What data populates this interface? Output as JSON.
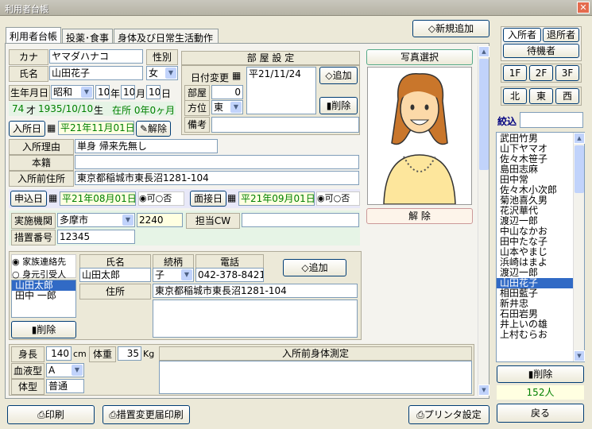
{
  "window": {
    "title": "利用者台帳",
    "close": "✕"
  },
  "tabs": [
    "利用者台帳",
    "投薬･食事",
    "身体及び日常生活動作"
  ],
  "new_button": "新規追加",
  "basic": {
    "kana_label": "カナ",
    "kana": "ヤマダハナコ",
    "sex_label": "性別",
    "name_label": "氏名",
    "name": "山田花子",
    "sex": "女",
    "birth_label": "生年月日",
    "era": "昭和",
    "year": "10",
    "year_unit": "年",
    "month": "10",
    "month_unit": "月",
    "day": "10",
    "day_unit": "日",
    "age": "74",
    "age_unit": "才",
    "birth_ad": "1935/10/10",
    "birth_ad_unit": "生",
    "stay": "在所 0年0ヶ月"
  },
  "admission": {
    "label": "入所日",
    "date": "平21年11月01日",
    "release": "解除"
  },
  "room": {
    "header": "部 屋 設 定",
    "date_change": "日付変更",
    "room_label": "部屋",
    "room_value": "0",
    "direction_label": "方位",
    "direction": "東",
    "remarks_label": "備考",
    "list": [
      "平21/11/24"
    ],
    "add": "追加",
    "delete": "削除"
  },
  "photo": {
    "select": "写真選択",
    "release": "解 除"
  },
  "reason": {
    "label": "入所理由",
    "value": "単身 帰来先無し"
  },
  "honseki": {
    "label": "本籍",
    "value": ""
  },
  "prev_addr": {
    "label": "入所前住所",
    "value": "東京都稲城市東長沼1281-104"
  },
  "application": {
    "label": "申込日",
    "date": "平21年08月01日",
    "ok": "可",
    "ng": "否"
  },
  "interview": {
    "label": "面接日",
    "date": "平21年09月01日",
    "ok": "可",
    "ng": "否"
  },
  "agency": {
    "label": "実施機関",
    "value": "多摩市",
    "code": "2240",
    "cw_label": "担当CW",
    "cw": ""
  },
  "measure": {
    "label": "措置番号",
    "value": "12345"
  },
  "contact": {
    "opt1": "家族連絡先",
    "opt2": "身元引受人",
    "list": [
      "山田太郎",
      "田中 一郎"
    ],
    "delete": "削除",
    "name_h": "氏名",
    "rel_h": "続柄",
    "tel_h": "電話",
    "name": "山田太郎",
    "rel": "子",
    "tel": "042-378-8421",
    "add": "追加",
    "addr_label": "住所",
    "addr": "東京都稲城市東長沼1281-104"
  },
  "body": {
    "height_label": "身長",
    "height": "140",
    "height_unit": "cm",
    "weight_label": "体重",
    "weight": "35",
    "weight_unit": "Kg",
    "blood_label": "血液型",
    "blood": "A",
    "type_label": "体型",
    "type": "普通",
    "measure_header": "入所前身体測定"
  },
  "right": {
    "status": [
      "入所者",
      "退所者",
      "待機者"
    ],
    "floors": [
      "1F",
      "2F",
      "3F"
    ],
    "directions": [
      "北",
      "東",
      "西"
    ],
    "filter_label": "絞込",
    "residents": [
      "武田竹男",
      "山下ヤマオ",
      "佐々木笹子",
      "島田志麻",
      "田中常",
      "佐々木小次郎",
      "菊池喜久男",
      "花沢華代",
      "渡辺一郎",
      "中山なかお",
      "田中たな子",
      "山本やまじ",
      "浜崎はまよ",
      "渡辺一郎",
      "山田花子",
      "相田藍子",
      "新井忠",
      "石田岩男",
      "井上いの雄",
      "上村むらお"
    ],
    "selected": "山田花子",
    "delete": "削除",
    "count": "152人",
    "back": "戻る"
  },
  "footer": {
    "print": "印刷",
    "measure_print": "措置変更届印刷",
    "printer": "プリンタ設定"
  }
}
